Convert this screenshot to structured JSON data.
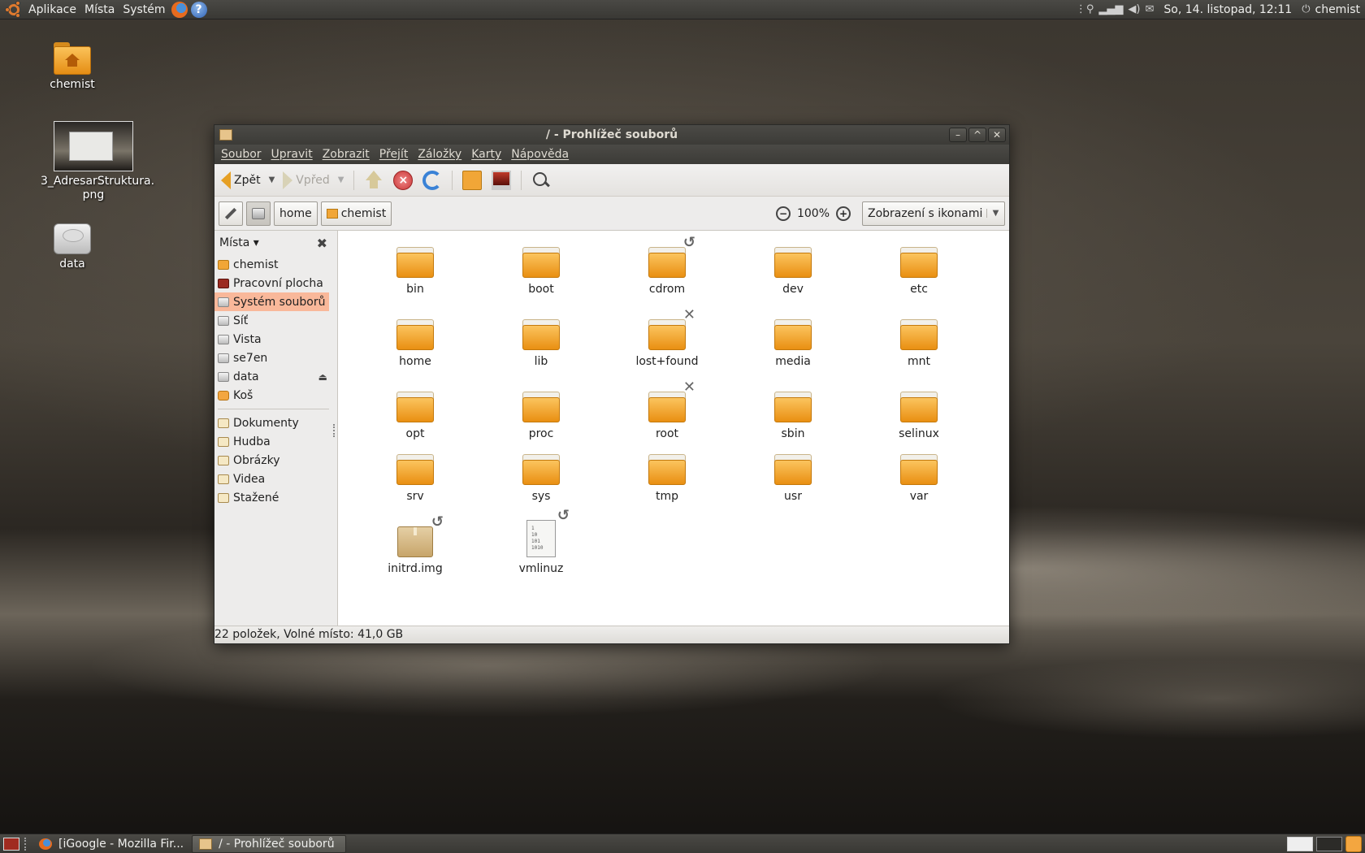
{
  "top_panel": {
    "menus": [
      "Aplikace",
      "Místa",
      "Systém"
    ],
    "help_glyph": "?",
    "clock": "So, 14. listopad, 12:11",
    "user": "chemist",
    "power_glyph": "⏻",
    "tray_icons": [
      "network-icon",
      "signal-icon",
      "volume-icon",
      "mail-icon"
    ]
  },
  "desktop": {
    "icons": [
      {
        "label": "chemist",
        "icon": "home-folder-icon"
      },
      {
        "label": "3_AdresarStruktura.\npng",
        "icon": "image-thumbnail"
      },
      {
        "label": "data",
        "icon": "drive-icon"
      }
    ]
  },
  "window": {
    "title": "/ - Prohlížeč souborů",
    "menus": [
      "Soubor",
      "Upravit",
      "Zobrazit",
      "Přejít",
      "Záložky",
      "Karty",
      "Nápověda"
    ],
    "toolbar": {
      "back_label": "Zpět",
      "forward_label": "Vpřed"
    },
    "location": {
      "path": [
        "home",
        "chemist"
      ],
      "zoom": "100%",
      "view_mode": "Zobrazení s ikonami"
    },
    "sidebar": {
      "title": "Místa",
      "places": [
        {
          "label": "chemist",
          "icon": "home-icon"
        },
        {
          "label": "Pracovní plocha",
          "icon": "desktop-icon"
        },
        {
          "label": "Systém souborů",
          "icon": "filesystem-icon",
          "selected": true
        },
        {
          "label": "Síť",
          "icon": "network-icon"
        },
        {
          "label": "Vista",
          "icon": "drive-icon"
        },
        {
          "label": "se7en",
          "icon": "drive-icon"
        },
        {
          "label": "data",
          "icon": "drive-icon",
          "eject": true
        },
        {
          "label": "Koš",
          "icon": "trash-icon"
        }
      ],
      "bookmarks": [
        {
          "label": "Dokumenty",
          "icon": "documents-icon"
        },
        {
          "label": "Hudba",
          "icon": "music-icon"
        },
        {
          "label": "Obrázky",
          "icon": "pictures-icon"
        },
        {
          "label": "Videa",
          "icon": "videos-icon"
        },
        {
          "label": "Stažené",
          "icon": "downloads-icon"
        }
      ]
    },
    "files": [
      {
        "name": "bin",
        "type": "folder"
      },
      {
        "name": "boot",
        "type": "folder"
      },
      {
        "name": "cdrom",
        "type": "folder",
        "emblem": "symlink"
      },
      {
        "name": "dev",
        "type": "folder"
      },
      {
        "name": "etc",
        "type": "folder"
      },
      {
        "name": "home",
        "type": "folder"
      },
      {
        "name": "lib",
        "type": "folder"
      },
      {
        "name": "lost+found",
        "type": "folder",
        "emblem": "noaccess"
      },
      {
        "name": "media",
        "type": "folder"
      },
      {
        "name": "mnt",
        "type": "folder"
      },
      {
        "name": "opt",
        "type": "folder"
      },
      {
        "name": "proc",
        "type": "folder"
      },
      {
        "name": "root",
        "type": "folder",
        "emblem": "noaccess"
      },
      {
        "name": "sbin",
        "type": "folder"
      },
      {
        "name": "selinux",
        "type": "folder"
      },
      {
        "name": "srv",
        "type": "folder"
      },
      {
        "name": "sys",
        "type": "folder"
      },
      {
        "name": "tmp",
        "type": "folder"
      },
      {
        "name": "usr",
        "type": "folder"
      },
      {
        "name": "var",
        "type": "folder"
      },
      {
        "name": "initrd.img",
        "type": "package",
        "emblem": "symlink"
      },
      {
        "name": "vmlinuz",
        "type": "binary",
        "emblem": "symlink",
        "content": "1\n10\n101\n1010"
      }
    ],
    "status": "22 položek, Volné místo: 41,0 GB"
  },
  "bottom_panel": {
    "tasks": [
      {
        "label": "[iGoogle - Mozilla Fir...",
        "icon": "firefox-icon"
      },
      {
        "label": "/ - Prohlížeč souborů",
        "icon": "file-manager-icon",
        "active": true
      }
    ]
  }
}
